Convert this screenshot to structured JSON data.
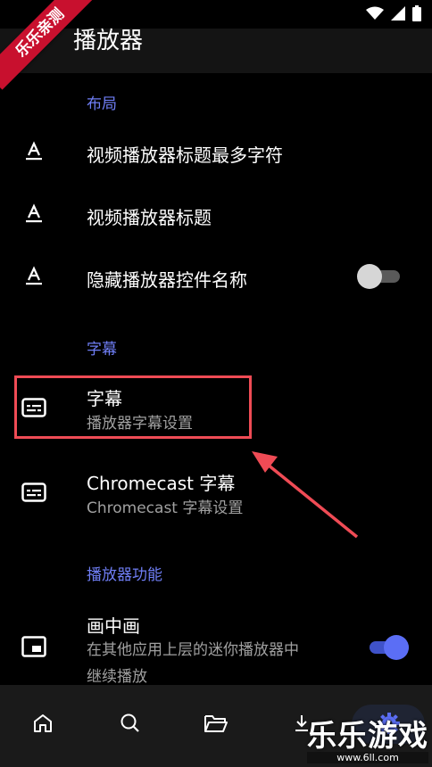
{
  "app": {
    "title": "播放器"
  },
  "ribbon": {
    "label": "乐乐亲测"
  },
  "sections": {
    "layout": "布局",
    "subtitles": "字幕",
    "player_features": "播放器功能"
  },
  "items": {
    "max_title_chars": {
      "title": "视频播放器标题最多字符",
      "icon": "text-format-icon"
    },
    "player_title": {
      "title": "视频播放器标题",
      "icon": "text-format-icon"
    },
    "hide_control_names": {
      "title": "隐藏播放器控件名称",
      "icon": "text-format-icon",
      "toggle": false
    },
    "subtitles": {
      "title": "字幕",
      "subtitle": "播放器字幕设置",
      "icon": "subtitles-icon"
    },
    "chromecast_subtitles": {
      "title": "Chromecast 字幕",
      "subtitle": "Chromecast 字幕设置",
      "icon": "subtitles-icon"
    },
    "pip": {
      "title": "画中画",
      "subtitle_line1": "在其他应用上层的迷你播放器中",
      "subtitle_line2": "继续播放",
      "icon": "picture-in-picture-icon",
      "toggle": true
    }
  },
  "bottom_nav": [
    "home-icon",
    "search-icon",
    "folder-icon",
    "download-icon",
    "settings-icon"
  ],
  "watermark": {
    "brand": "乐乐游戏",
    "url": "www.6ll.com"
  },
  "colors": {
    "accent": "#6f7ef5",
    "switch_on": "#5b6ef5",
    "highlight": "#ef4b55"
  }
}
